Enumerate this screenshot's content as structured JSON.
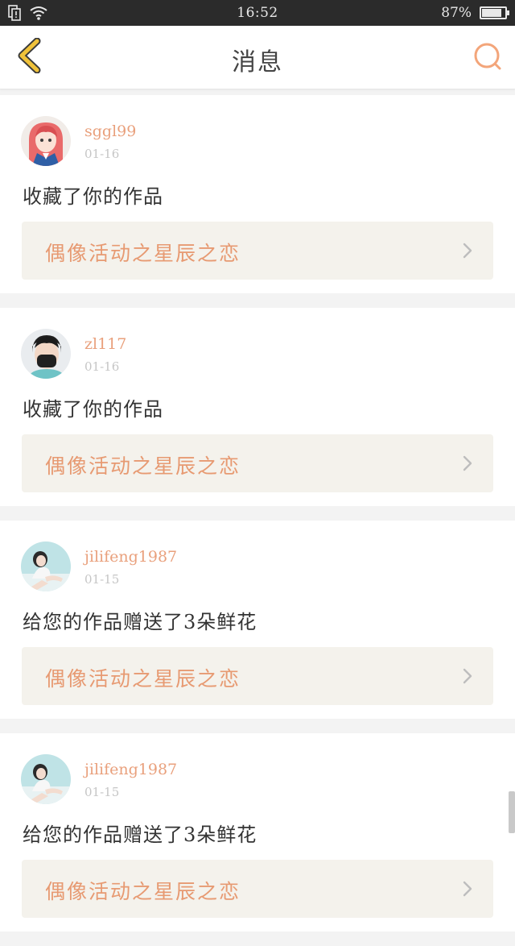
{
  "status_bar": {
    "time": "16:52",
    "battery_text": "87%",
    "battery_level": 0.87
  },
  "header": {
    "title": "消息"
  },
  "messages": [
    {
      "username": "sggl99",
      "date": "01-16",
      "action": "收藏了你的作品",
      "work_title": "偶像活动之星辰之恋",
      "avatar": "avatar-girl-red-hair"
    },
    {
      "username": "zl117",
      "date": "01-16",
      "action": "收藏了你的作品",
      "work_title": "偶像活动之星辰之恋",
      "avatar": "avatar-boy-mask"
    },
    {
      "username": "jilifeng1987",
      "date": "01-15",
      "action": "给您的作品赠送了3朵鲜花",
      "work_title": "偶像活动之星辰之恋",
      "avatar": "avatar-girl-sitting"
    },
    {
      "username": "jilifeng1987",
      "date": "01-15",
      "action": "给您的作品赠送了3朵鲜花",
      "work_title": "偶像活动之星辰之恋",
      "avatar": "avatar-girl-sitting"
    }
  ],
  "colors": {
    "accent": "#e79a72",
    "back_arrow": "#f0c23a",
    "search_ring": "#f3a57a",
    "link_bg": "#f4f2ec"
  }
}
